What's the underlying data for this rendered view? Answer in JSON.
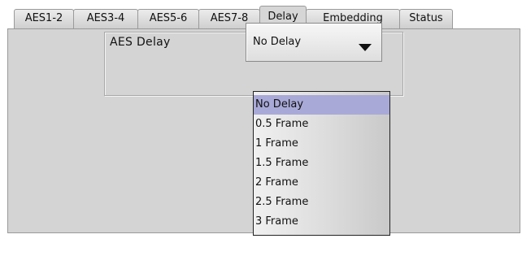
{
  "tabs": [
    {
      "label": "AES1-2"
    },
    {
      "label": "AES3-4"
    },
    {
      "label": "AES5-6"
    },
    {
      "label": "AES7-8"
    },
    {
      "label": "Delay",
      "active": true
    },
    {
      "label": "Embedding"
    },
    {
      "label": "Status"
    }
  ],
  "delay": {
    "field_label": "AES Delay",
    "selected_value": "No Delay",
    "arrow_icon": "triangle-down-icon",
    "options": [
      {
        "label": "No Delay",
        "selected": true
      },
      {
        "label": "0.5 Frame"
      },
      {
        "label": "1 Frame"
      },
      {
        "label": "1.5 Frame"
      },
      {
        "label": "2 Frame"
      },
      {
        "label": "2.5 Frame"
      },
      {
        "label": "3 Frame"
      }
    ]
  },
  "colors": {
    "panel_bg": "#d4d4d4",
    "selected_option_bg": "#a9a9d8",
    "tab_border": "#9a9a9a"
  }
}
